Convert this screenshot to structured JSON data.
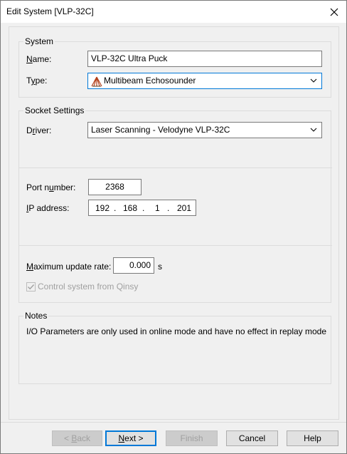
{
  "window": {
    "title": "Edit System [VLP-32C]"
  },
  "system_group": {
    "title": "System",
    "name_label_u": "N",
    "name_label_rest": "ame:",
    "name_value": "VLP-32C Ultra Puck",
    "type_label_pre": "T",
    "type_label_u": "y",
    "type_label_rest": "pe:",
    "type_value": "Multibeam Echosounder"
  },
  "socket_group": {
    "title": "Socket Settings",
    "driver_label_pre": "D",
    "driver_label_u": "r",
    "driver_label_rest": "iver:",
    "driver_value": "Laser Scanning - Velodyne VLP-32C",
    "port_label_pre": "Port n",
    "port_label_u": "u",
    "port_label_rest": "mber:",
    "port_value": "2368",
    "ip_label_u": "I",
    "ip_label_rest": "P address:",
    "ip_octets": [
      "192",
      "168",
      "1",
      "201"
    ],
    "ip_dot": ".",
    "rate_label_u": "M",
    "rate_label_rest": "aximum update rate:",
    "rate_value": "0.000",
    "rate_unit": "s",
    "control_label": "Control system from Qinsy"
  },
  "notes_group": {
    "title": "Notes",
    "text": "I/O Parameters are only used in online mode and have no effect in replay mode"
  },
  "buttons": {
    "back_pre": "< ",
    "back_u": "B",
    "back_rest": "ack",
    "next_u": "N",
    "next_rest": "ext >",
    "finish": "Finish",
    "cancel": "Cancel",
    "help": "Help"
  },
  "icons": {
    "close": "close-icon",
    "multibeam": "multibeam-icon",
    "dropdown": "chevron-down-icon",
    "checkbox": "checkbox-checked-icon"
  }
}
